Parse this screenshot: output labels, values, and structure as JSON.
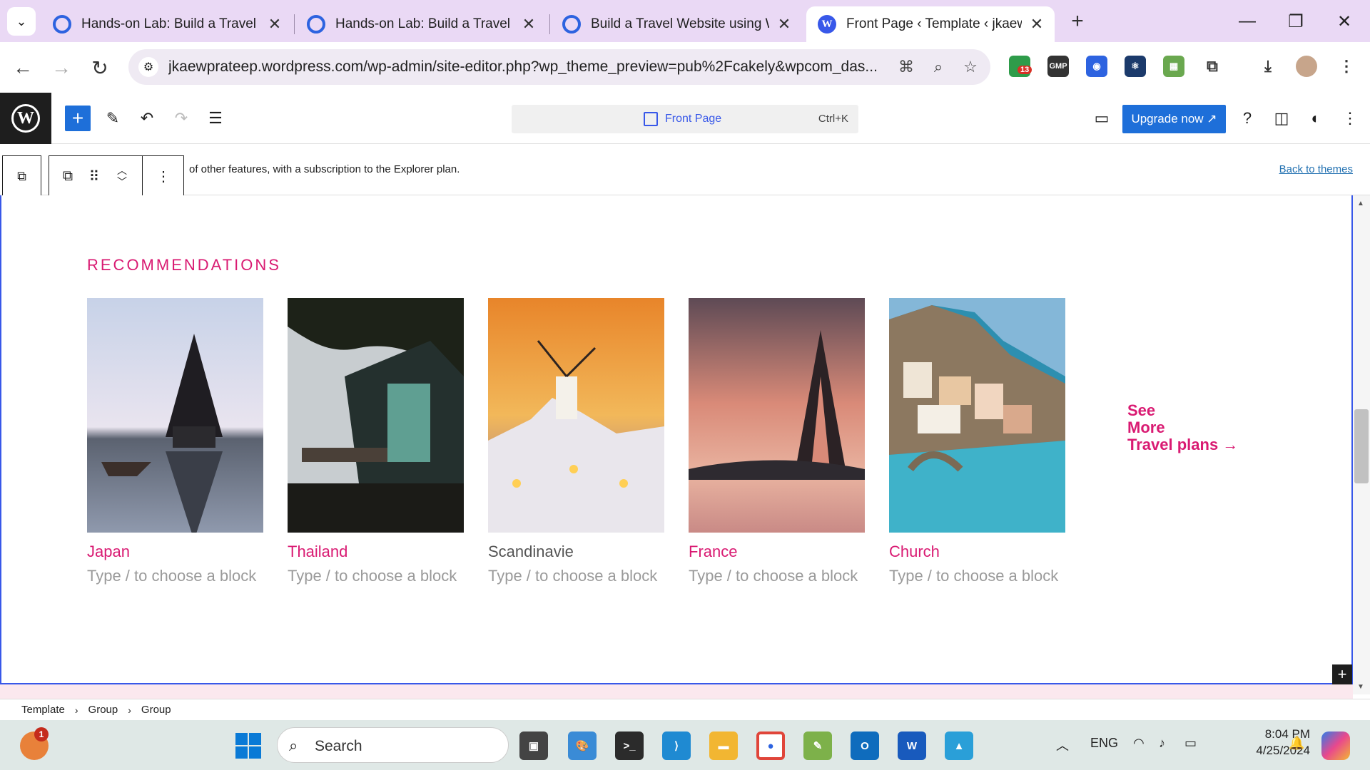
{
  "browser": {
    "tabs": [
      {
        "title": "Hands-on Lab: Build a Travel W",
        "icon": "google-icon"
      },
      {
        "title": "Hands-on Lab: Build a Travel W",
        "icon": "google-icon"
      },
      {
        "title": "Build a Travel Website using W",
        "icon": "google-icon"
      },
      {
        "title": "Front Page ‹ Template ‹ jkaewpr",
        "icon": "wordpress-icon",
        "active": true
      }
    ],
    "url": "jkaewprateep.wordpress.com/wp-admin/site-editor.php?wp_theme_preview=pub%2Fcakely&wpcom_das...",
    "extension_badge": "13",
    "ext_gmp_label": "GMP"
  },
  "editor": {
    "command_title": "Front Page",
    "command_shortcut": "Ctrl+K",
    "upgrade_label": "Upgrade now",
    "notice_text": "of other features, with a subscription to the Explorer plan.",
    "back_to_themes": "Back to themes"
  },
  "content": {
    "heading": "RECOMMENDATIONS",
    "placeholder": "Type / to choose a block",
    "cards": [
      {
        "title": "Japan"
      },
      {
        "title": "Thailand"
      },
      {
        "title": "Scandinavie"
      },
      {
        "title": "France"
      },
      {
        "title": "Church"
      }
    ],
    "see_more_line1": "See",
    "see_more_line2": "More",
    "see_more_line3": "Travel plans →"
  },
  "breadcrumb": [
    "Template",
    "Group",
    "Group"
  ],
  "taskbar": {
    "search_label": "Search",
    "notification_badge": "1",
    "language": "ENG",
    "time": "8:04 PM",
    "date": "4/25/2024"
  },
  "colors": {
    "accent_pink": "#d91a72",
    "wp_blue": "#1e6fd9",
    "tab_bar": "#ead9f5"
  }
}
